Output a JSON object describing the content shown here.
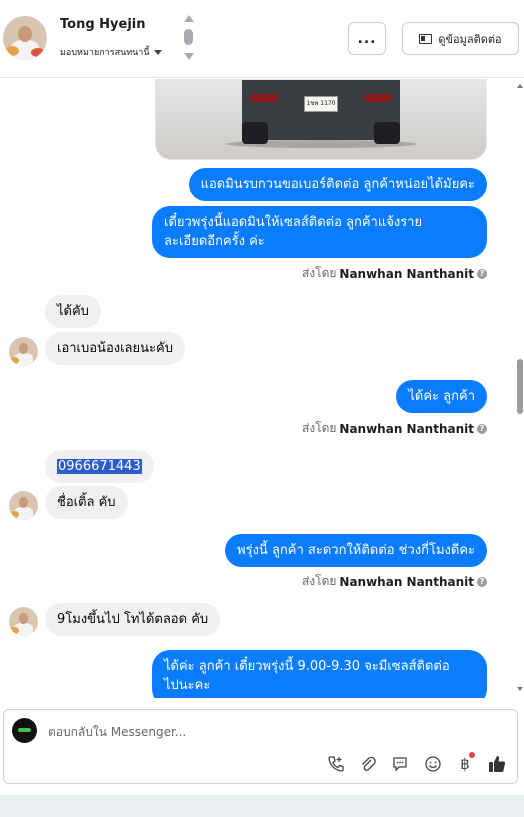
{
  "header": {
    "contact_name": "Tong Hyejin",
    "assign_label": "มอบหมายการสนทนานี้",
    "more_label": "...",
    "view_contact_label": "ดูข้อมูลติดต่อ"
  },
  "photo": {
    "plate_text": "1ขพ 1170"
  },
  "messages": {
    "m1": "แอดมินรบกวนขอเบอร์ติดต่อ ลูกค้าหน่อยได้มัยคะ",
    "m2_line1": "เดี๋ยวพรุ่งนี้แอดมินให้เซลส์ติดต่อ ลูกค้าแจ้งราย",
    "m2_line2": "ละเอียดอีกครั้ง ค่ะ",
    "m3": "ได้คับ",
    "m4": "เอาเบอน้องเลยนะคับ",
    "m5": "ได้ค่ะ  ลูกค้า",
    "m6": "0966671443",
    "m7": "ชื่อเติ้ล คับ",
    "m8": "พรุ่งนี้ ลูกค้า สะดวกให้ติดต่อ ช่วงกี่โมงดีคะ",
    "m9": "9โมงขึ้นไป โทได้ตลอด คับ",
    "m10_line1": "ได้ค่ะ  ลูกค้า เดี๋ยวพรุ่งนี้  9.00-9.30 จะมีเซลส์ติดต่อ",
    "m10_line2": "ไปนะคะ"
  },
  "sent_by": {
    "prefix": "ส่งโดย",
    "agent_name": "Nanwhan Nanthanit"
  },
  "composer": {
    "placeholder": "ตอบกลับใน Messenger..."
  },
  "icons": {
    "more": "more-icon",
    "contact": "contact-card-icon",
    "call": "phone-add-icon",
    "attach": "paperclip-icon",
    "saved_reply": "chat-bubble-icon",
    "emoji": "smiley-icon",
    "payment": "baht-icon",
    "like": "thumbs-up-icon"
  },
  "colors": {
    "outgoing_bubble": "#0a7cff",
    "incoming_bubble": "#f0f0f0",
    "accent": "#0a7cff"
  }
}
